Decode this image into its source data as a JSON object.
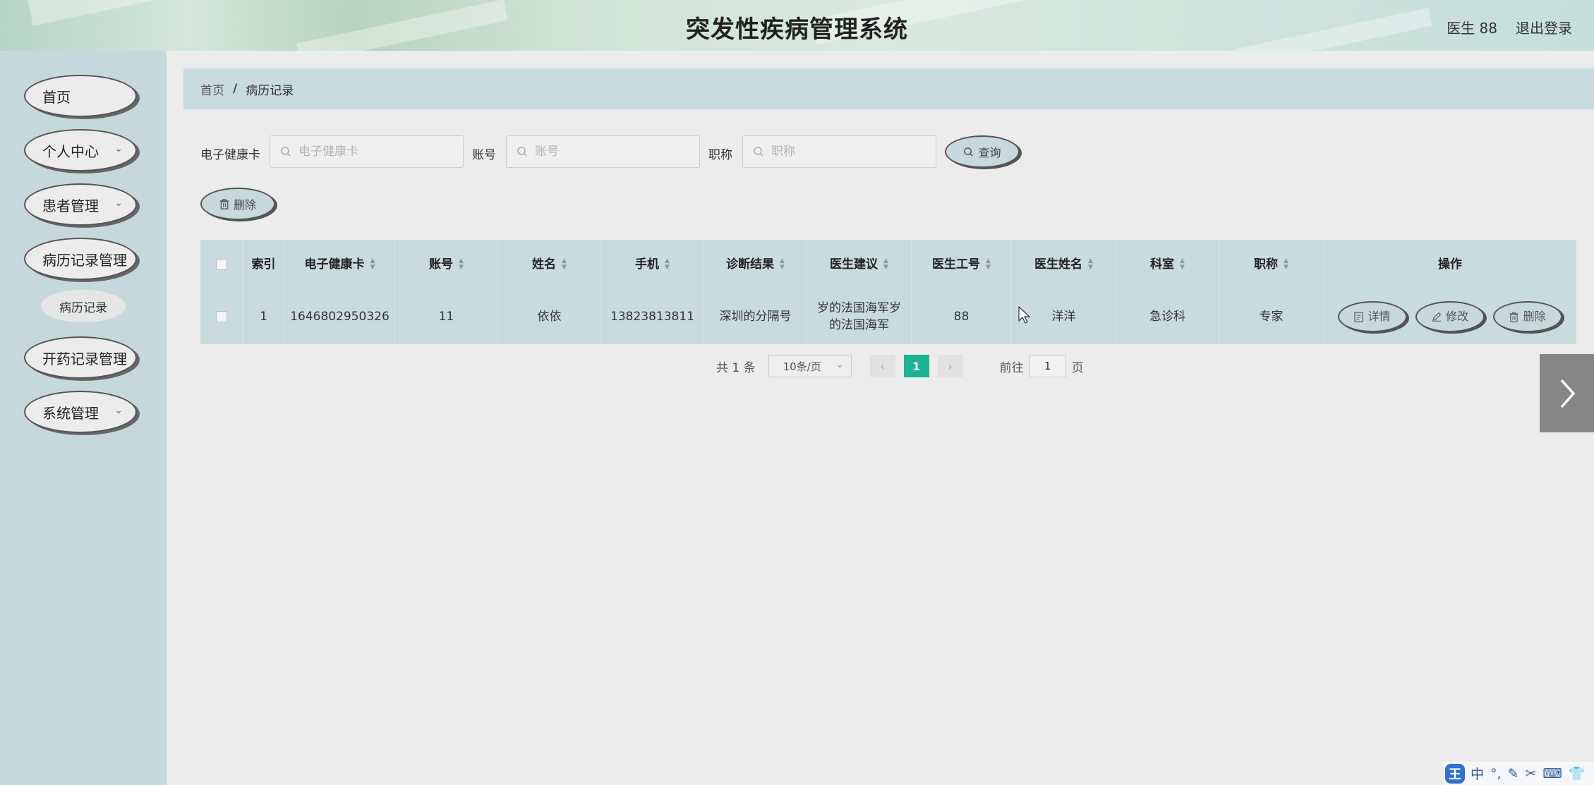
{
  "app": {
    "title": "突发性疾病管理系统",
    "user": "医生 88",
    "logout": "退出登录"
  },
  "sidebar": {
    "items": [
      {
        "label": "首页",
        "has_children": false
      },
      {
        "label": "个人中心",
        "has_children": true
      },
      {
        "label": "患者管理",
        "has_children": true
      },
      {
        "label": "病历记录管理",
        "has_children": false
      },
      {
        "label": "开药记录管理",
        "has_children": false
      },
      {
        "label": "系统管理",
        "has_children": true
      }
    ],
    "subitems": [
      {
        "label": "病历记录",
        "parent": "病历记录管理"
      }
    ]
  },
  "breadcrumb": {
    "home": "首页",
    "separator": "/",
    "current": "病历记录"
  },
  "search": {
    "card_label": "电子健康卡",
    "card_placeholder": "电子健康卡",
    "account_label": "账号",
    "account_placeholder": "账号",
    "title_label": "职称",
    "title_placeholder": "职称",
    "query_button": "查询",
    "delete_button": "删除"
  },
  "table": {
    "headers": [
      "索引",
      "电子健康卡",
      "账号",
      "姓名",
      "手机",
      "诊断结果",
      "医生建议",
      "医生工号",
      "医生姓名",
      "科室",
      "职称",
      "操作"
    ],
    "rows": [
      {
        "index": "1",
        "card": "1646802950326",
        "account": "11",
        "name": "依依",
        "phone": "13823813811",
        "diagnosis": "深圳的分隔号",
        "advice": "岁的法国海军岁的法国海军",
        "doctor_id": "88",
        "doctor_name": "洋洋",
        "department": "急诊科",
        "title": "专家",
        "actions": {
          "detail": "详情",
          "edit": "修改",
          "delete": "删除"
        }
      }
    ]
  },
  "pagination": {
    "total": "共 1 条",
    "page_size": "10条/页",
    "current_page": "1",
    "goto_label": "前往",
    "goto_value": "1",
    "goto_suffix": "页"
  },
  "ime": {
    "logo": "王",
    "mode": "中"
  },
  "colors": {
    "accent": "#1ab394",
    "sidebar_bg": "#c6d9da",
    "panel_bg": "#c9dcdd",
    "page_bg": "#ececec"
  }
}
